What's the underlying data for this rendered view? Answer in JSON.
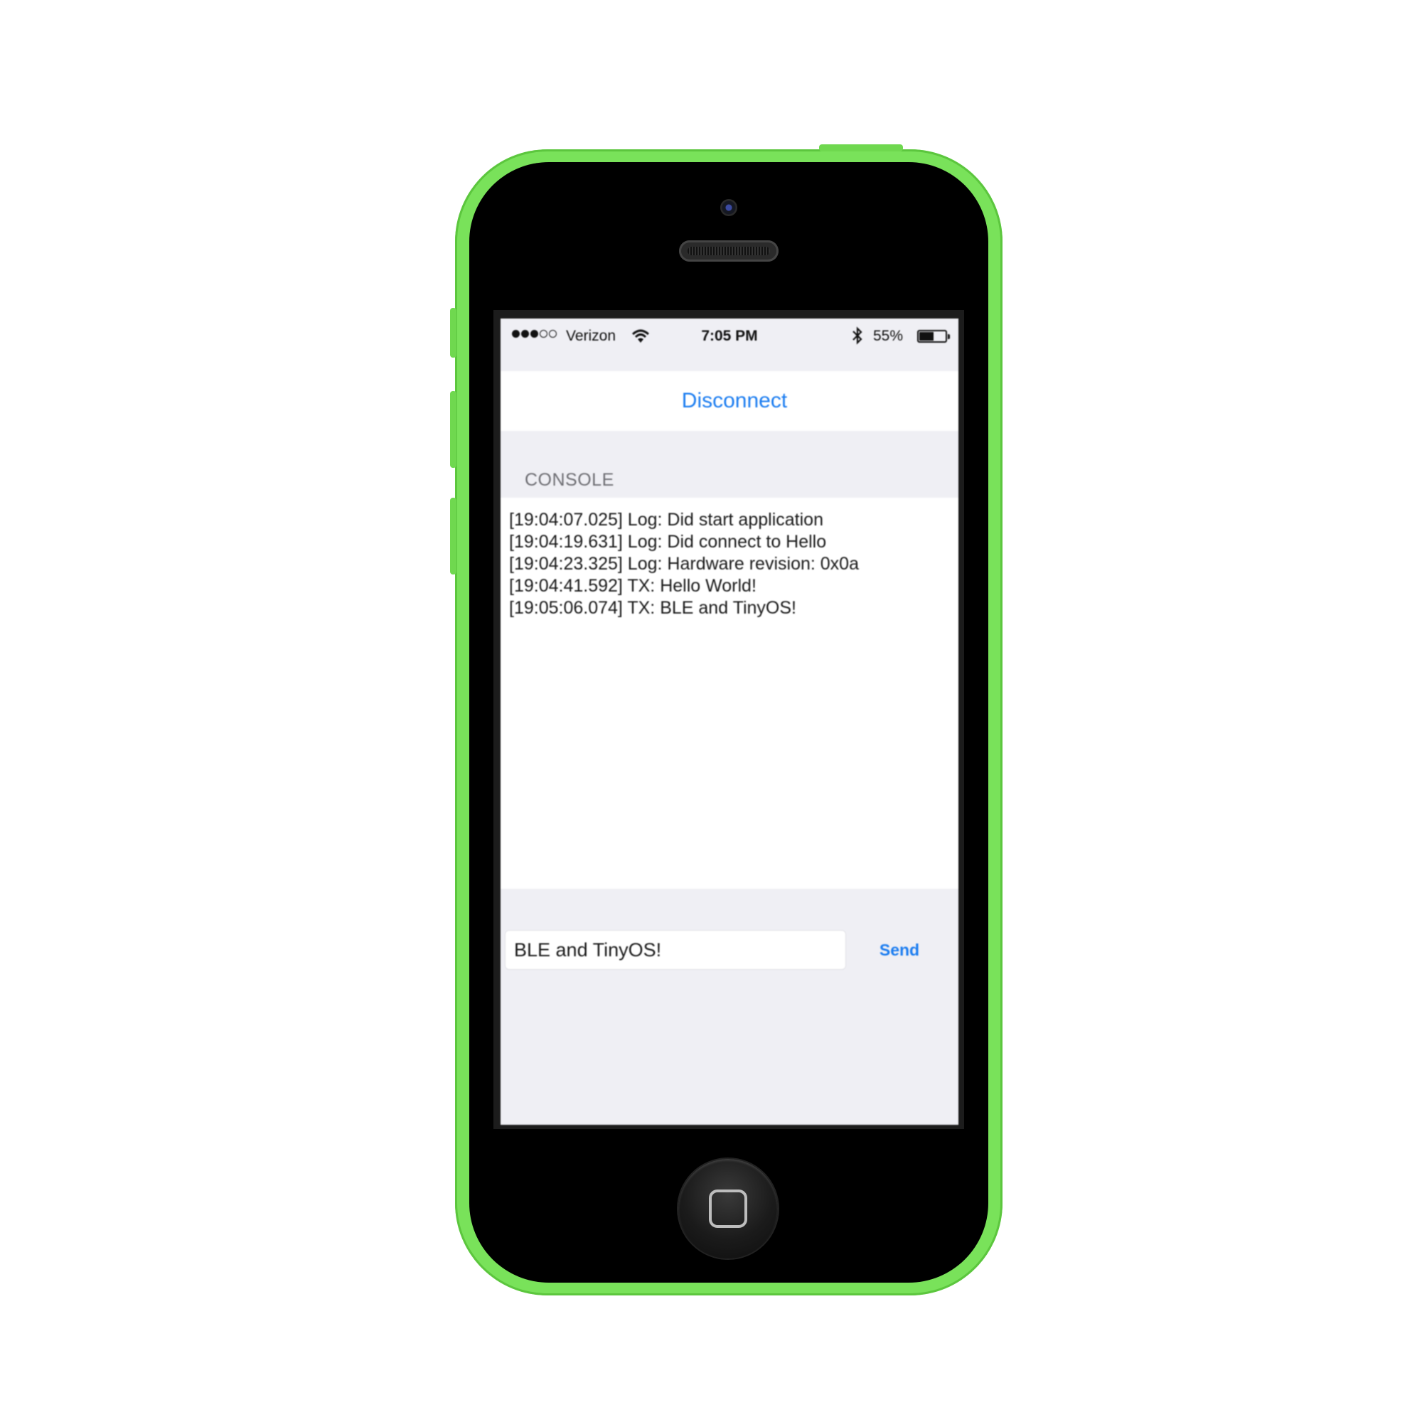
{
  "status_bar": {
    "signal_bars": [
      true,
      true,
      true,
      false,
      false
    ],
    "carrier": "Verizon",
    "time": "7:05 PM",
    "battery_percent_label": "55%",
    "battery_level": 0.55,
    "icons": [
      "wifi-icon",
      "bluetooth-icon",
      "battery-icon"
    ]
  },
  "actions": {
    "disconnect_label": "Disconnect"
  },
  "console": {
    "header": "CONSOLE",
    "lines": [
      "[19:04:07.025] Log: Did start application",
      "[19:04:19.631] Log: Did connect to Hello",
      "[19:04:23.325] Log: Hardware revision: 0x0a",
      "[19:04:41.592] TX: Hello World!",
      "[19:05:06.074] TX: BLE and TinyOS!"
    ]
  },
  "composer": {
    "input_value": "BLE and TinyOS!",
    "send_label": "Send"
  },
  "colors": {
    "phone_shell": "#79e25a",
    "ios_blue": "#1a7cf0",
    "group_background": "#efeff4"
  }
}
